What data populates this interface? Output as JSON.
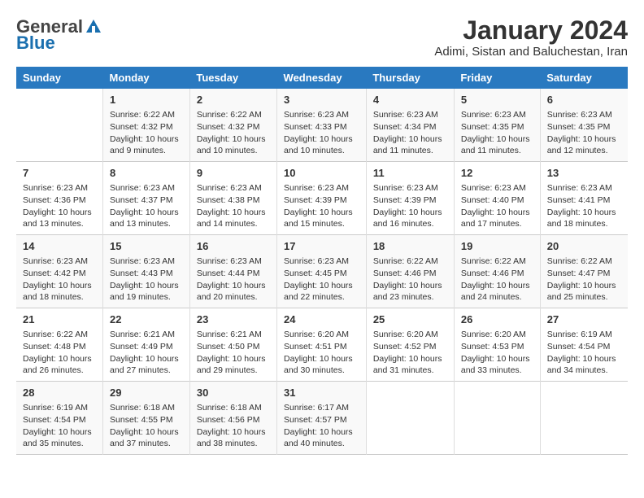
{
  "header": {
    "logo_general": "General",
    "logo_blue": "Blue",
    "month_year": "January 2024",
    "location": "Adimi, Sistan and Baluchestan, Iran"
  },
  "days_of_week": [
    "Sunday",
    "Monday",
    "Tuesday",
    "Wednesday",
    "Thursday",
    "Friday",
    "Saturday"
  ],
  "weeks": [
    [
      {
        "day": "",
        "info": ""
      },
      {
        "day": "1",
        "info": "Sunrise: 6:22 AM\nSunset: 4:32 PM\nDaylight: 10 hours\nand 9 minutes."
      },
      {
        "day": "2",
        "info": "Sunrise: 6:22 AM\nSunset: 4:32 PM\nDaylight: 10 hours\nand 10 minutes."
      },
      {
        "day": "3",
        "info": "Sunrise: 6:23 AM\nSunset: 4:33 PM\nDaylight: 10 hours\nand 10 minutes."
      },
      {
        "day": "4",
        "info": "Sunrise: 6:23 AM\nSunset: 4:34 PM\nDaylight: 10 hours\nand 11 minutes."
      },
      {
        "day": "5",
        "info": "Sunrise: 6:23 AM\nSunset: 4:35 PM\nDaylight: 10 hours\nand 11 minutes."
      },
      {
        "day": "6",
        "info": "Sunrise: 6:23 AM\nSunset: 4:35 PM\nDaylight: 10 hours\nand 12 minutes."
      }
    ],
    [
      {
        "day": "7",
        "info": "Sunrise: 6:23 AM\nSunset: 4:36 PM\nDaylight: 10 hours\nand 13 minutes."
      },
      {
        "day": "8",
        "info": "Sunrise: 6:23 AM\nSunset: 4:37 PM\nDaylight: 10 hours\nand 13 minutes."
      },
      {
        "day": "9",
        "info": "Sunrise: 6:23 AM\nSunset: 4:38 PM\nDaylight: 10 hours\nand 14 minutes."
      },
      {
        "day": "10",
        "info": "Sunrise: 6:23 AM\nSunset: 4:39 PM\nDaylight: 10 hours\nand 15 minutes."
      },
      {
        "day": "11",
        "info": "Sunrise: 6:23 AM\nSunset: 4:39 PM\nDaylight: 10 hours\nand 16 minutes."
      },
      {
        "day": "12",
        "info": "Sunrise: 6:23 AM\nSunset: 4:40 PM\nDaylight: 10 hours\nand 17 minutes."
      },
      {
        "day": "13",
        "info": "Sunrise: 6:23 AM\nSunset: 4:41 PM\nDaylight: 10 hours\nand 18 minutes."
      }
    ],
    [
      {
        "day": "14",
        "info": "Sunrise: 6:23 AM\nSunset: 4:42 PM\nDaylight: 10 hours\nand 18 minutes."
      },
      {
        "day": "15",
        "info": "Sunrise: 6:23 AM\nSunset: 4:43 PM\nDaylight: 10 hours\nand 19 minutes."
      },
      {
        "day": "16",
        "info": "Sunrise: 6:23 AM\nSunset: 4:44 PM\nDaylight: 10 hours\nand 20 minutes."
      },
      {
        "day": "17",
        "info": "Sunrise: 6:23 AM\nSunset: 4:45 PM\nDaylight: 10 hours\nand 22 minutes."
      },
      {
        "day": "18",
        "info": "Sunrise: 6:22 AM\nSunset: 4:46 PM\nDaylight: 10 hours\nand 23 minutes."
      },
      {
        "day": "19",
        "info": "Sunrise: 6:22 AM\nSunset: 4:46 PM\nDaylight: 10 hours\nand 24 minutes."
      },
      {
        "day": "20",
        "info": "Sunrise: 6:22 AM\nSunset: 4:47 PM\nDaylight: 10 hours\nand 25 minutes."
      }
    ],
    [
      {
        "day": "21",
        "info": "Sunrise: 6:22 AM\nSunset: 4:48 PM\nDaylight: 10 hours\nand 26 minutes."
      },
      {
        "day": "22",
        "info": "Sunrise: 6:21 AM\nSunset: 4:49 PM\nDaylight: 10 hours\nand 27 minutes."
      },
      {
        "day": "23",
        "info": "Sunrise: 6:21 AM\nSunset: 4:50 PM\nDaylight: 10 hours\nand 29 minutes."
      },
      {
        "day": "24",
        "info": "Sunrise: 6:20 AM\nSunset: 4:51 PM\nDaylight: 10 hours\nand 30 minutes."
      },
      {
        "day": "25",
        "info": "Sunrise: 6:20 AM\nSunset: 4:52 PM\nDaylight: 10 hours\nand 31 minutes."
      },
      {
        "day": "26",
        "info": "Sunrise: 6:20 AM\nSunset: 4:53 PM\nDaylight: 10 hours\nand 33 minutes."
      },
      {
        "day": "27",
        "info": "Sunrise: 6:19 AM\nSunset: 4:54 PM\nDaylight: 10 hours\nand 34 minutes."
      }
    ],
    [
      {
        "day": "28",
        "info": "Sunrise: 6:19 AM\nSunset: 4:54 PM\nDaylight: 10 hours\nand 35 minutes."
      },
      {
        "day": "29",
        "info": "Sunrise: 6:18 AM\nSunset: 4:55 PM\nDaylight: 10 hours\nand 37 minutes."
      },
      {
        "day": "30",
        "info": "Sunrise: 6:18 AM\nSunset: 4:56 PM\nDaylight: 10 hours\nand 38 minutes."
      },
      {
        "day": "31",
        "info": "Sunrise: 6:17 AM\nSunset: 4:57 PM\nDaylight: 10 hours\nand 40 minutes."
      },
      {
        "day": "",
        "info": ""
      },
      {
        "day": "",
        "info": ""
      },
      {
        "day": "",
        "info": ""
      }
    ]
  ]
}
